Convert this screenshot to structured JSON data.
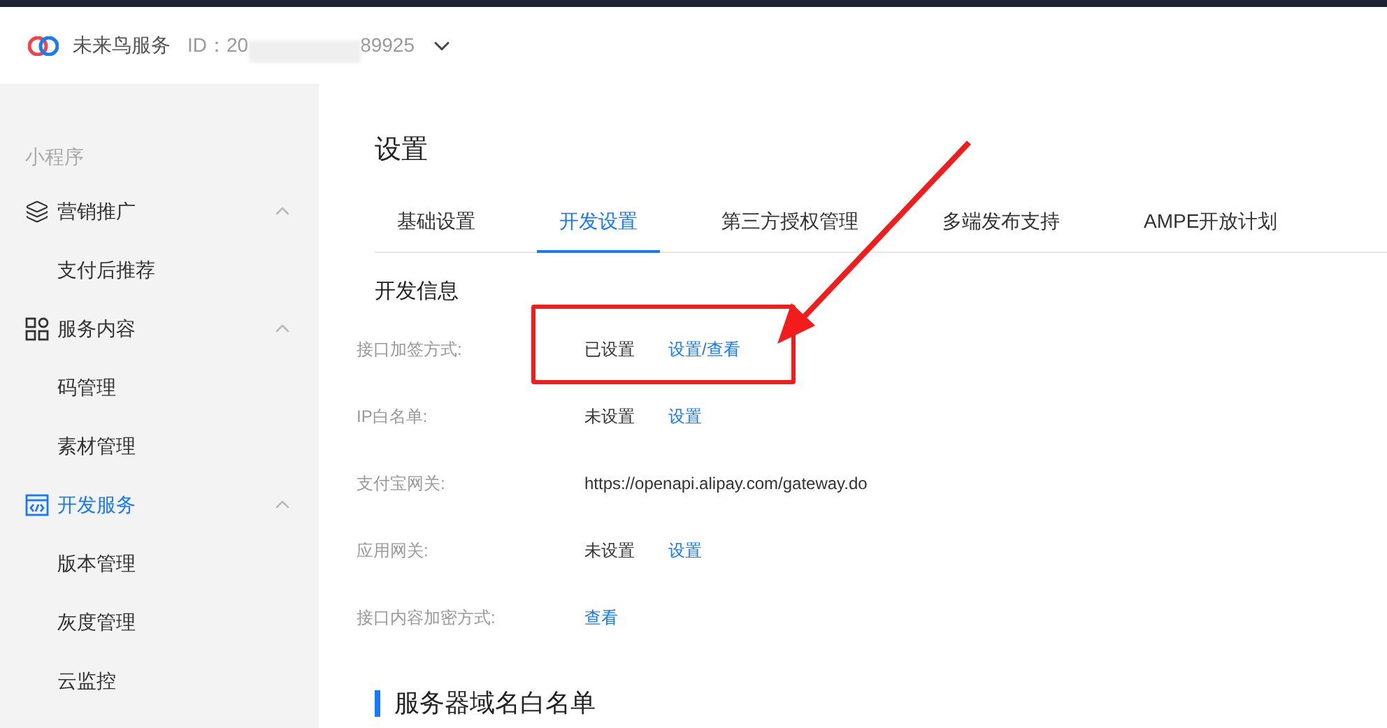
{
  "header": {
    "app_name": "未来鸟服务",
    "id_prefix": "ID：20",
    "id_suffix": "89925"
  },
  "sidebar": {
    "section": "小程序",
    "groups": [
      {
        "label": "营销推广",
        "expanded": true,
        "selected": false,
        "children": [
          {
            "label": "支付后推荐"
          }
        ]
      },
      {
        "label": "服务内容",
        "expanded": true,
        "selected": false,
        "children": [
          {
            "label": "码管理"
          },
          {
            "label": "素材管理"
          }
        ]
      },
      {
        "label": "开发服务",
        "expanded": true,
        "selected": true,
        "children": [
          {
            "label": "版本管理"
          },
          {
            "label": "灰度管理"
          },
          {
            "label": "云监控"
          }
        ]
      }
    ]
  },
  "main": {
    "title": "设置",
    "tabs": [
      {
        "label": "基础设置",
        "selected": false
      },
      {
        "label": "开发设置",
        "selected": true
      },
      {
        "label": "第三方授权管理",
        "selected": false
      },
      {
        "label": "多端发布支持",
        "selected": false
      },
      {
        "label": "AMPE开放计划",
        "selected": false
      }
    ],
    "section": "开发信息",
    "rows": [
      {
        "label": "接口加签方式:",
        "value": "已设置",
        "link": "设置/查看"
      },
      {
        "label": "IP白名单:",
        "value": "未设置",
        "link": "设置"
      },
      {
        "label": "支付宝网关:",
        "value": "https://openapi.alipay.com/gateway.do"
      },
      {
        "label": "应用网关:",
        "value": "未设置",
        "link": "设置"
      },
      {
        "label": "接口内容加密方式:",
        "link": "查看"
      }
    ],
    "section2": "服务器域名白名单"
  }
}
